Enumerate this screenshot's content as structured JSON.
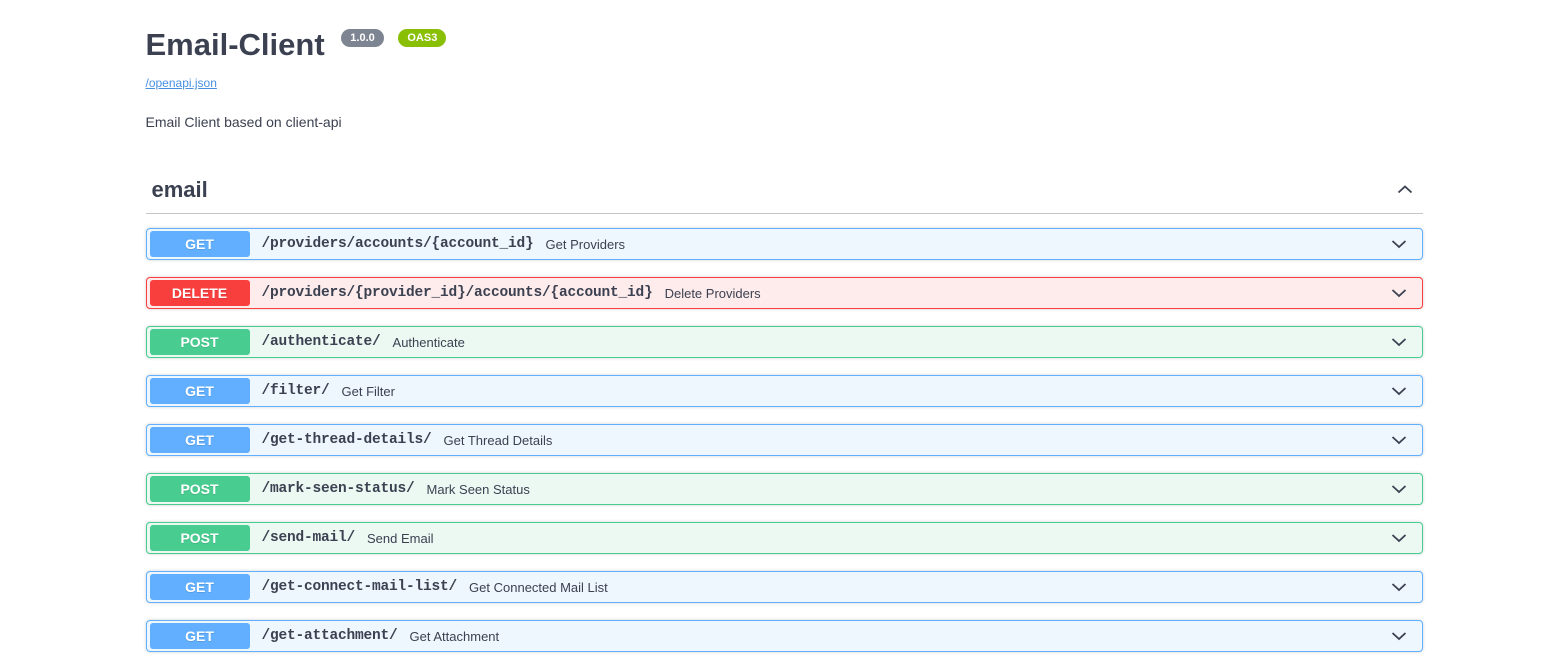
{
  "header": {
    "title": "Email-Client",
    "version": "1.0.0",
    "oas_label": "OAS3",
    "spec_link": "/openapi.json",
    "description": "Email Client based on client-api"
  },
  "section": {
    "title": "email"
  },
  "endpoints": [
    {
      "method": "GET",
      "path": "/providers/accounts/{account_id}",
      "summary": "Get Providers"
    },
    {
      "method": "DELETE",
      "path": "/providers/{provider_id}/accounts/{account_id}",
      "summary": "Delete Providers"
    },
    {
      "method": "POST",
      "path": "/authenticate/",
      "summary": "Authenticate"
    },
    {
      "method": "GET",
      "path": "/filter/",
      "summary": "Get Filter"
    },
    {
      "method": "GET",
      "path": "/get-thread-details/",
      "summary": "Get Thread Details"
    },
    {
      "method": "POST",
      "path": "/mark-seen-status/",
      "summary": "Mark Seen Status"
    },
    {
      "method": "POST",
      "path": "/send-mail/",
      "summary": "Send Email"
    },
    {
      "method": "GET",
      "path": "/get-connect-mail-list/",
      "summary": "Get Connected Mail List"
    },
    {
      "method": "GET",
      "path": "/get-attachment/",
      "summary": "Get Attachment"
    }
  ],
  "colors": {
    "get": "#61affe",
    "post": "#49cc90",
    "delete": "#f93e3e",
    "get_row_bg": "#eff7fe",
    "post_row_bg": "#ecf9f3",
    "delete_row_bg": "#feebeb",
    "version_badge_bg": "#7d8492",
    "oas_badge_bg": "#89bf04",
    "link": "#4990e2",
    "text": "#3b4151"
  }
}
